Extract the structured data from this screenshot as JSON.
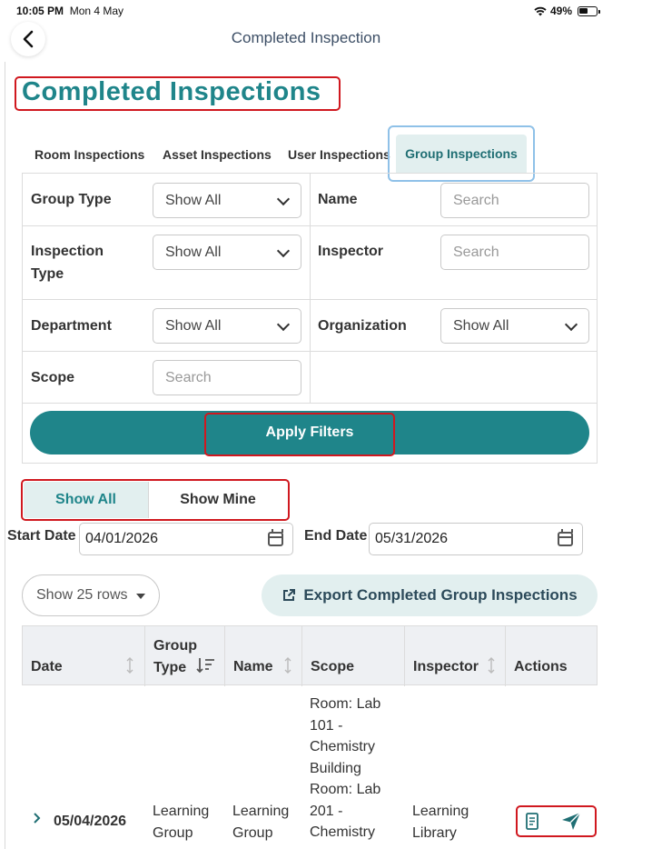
{
  "status": {
    "time": "10:05 PM",
    "date": "Mon 4 May",
    "battery": "49%"
  },
  "nav": {
    "title": "Completed Inspection"
  },
  "page": {
    "title": "Completed Inspections"
  },
  "tabs": [
    {
      "label": "Room Inspections"
    },
    {
      "label": "Asset Inspections"
    },
    {
      "label": "User Inspections"
    },
    {
      "label": "Group Inspections",
      "active": true
    }
  ],
  "filters": {
    "group_type": {
      "label": "Group Type",
      "value": "Show All"
    },
    "name": {
      "label": "Name",
      "placeholder": "Search"
    },
    "inspection_type": {
      "label_line1": "Inspection",
      "label_line2": "Type",
      "value": "Show All"
    },
    "inspector": {
      "label": "Inspector",
      "placeholder": "Search"
    },
    "department": {
      "label": "Department",
      "value": "Show All"
    },
    "organization": {
      "label": "Organization",
      "value": "Show All"
    },
    "scope": {
      "label": "Scope",
      "placeholder": "Search"
    },
    "apply_label": "Apply Filters"
  },
  "toggle": {
    "all_label": "Show All",
    "mine_label": "Show Mine"
  },
  "dates": {
    "start_label": "Start Date",
    "start_value": "04/01/2026",
    "end_label": "End Date",
    "end_value": "05/31/2026"
  },
  "table_controls": {
    "rows_label": "Show 25 rows",
    "export_label": "Export Completed Group Inspections"
  },
  "table": {
    "headers": {
      "date": "Date",
      "group_type_line1": "Group",
      "group_type_line2": "Type",
      "name": "Name",
      "scope": "Scope",
      "inspector": "Inspector",
      "actions": "Actions"
    },
    "row": {
      "date": "05/04/2026",
      "group_type_line1": "Learning",
      "group_type_line2": "Group",
      "name_line1": "Learning",
      "name_line2": "Group",
      "scope_lines": [
        "Room: Lab",
        "101 -",
        "Chemistry",
        "Building",
        "Room: Lab",
        "201 -",
        "Chemistry"
      ],
      "inspector_line1": "Learning",
      "inspector_line2": "Library"
    }
  },
  "colors": {
    "accent": "#1f858a",
    "highlight_red": "#d0181f",
    "tab_bg": "#e2efef"
  },
  "icons": [
    "back-icon",
    "wifi-icon",
    "battery-icon",
    "chevron-down-icon",
    "calendar-icon",
    "caret-down-icon",
    "export-icon",
    "sort-icon",
    "expand-icon",
    "report-icon",
    "send-icon"
  ]
}
